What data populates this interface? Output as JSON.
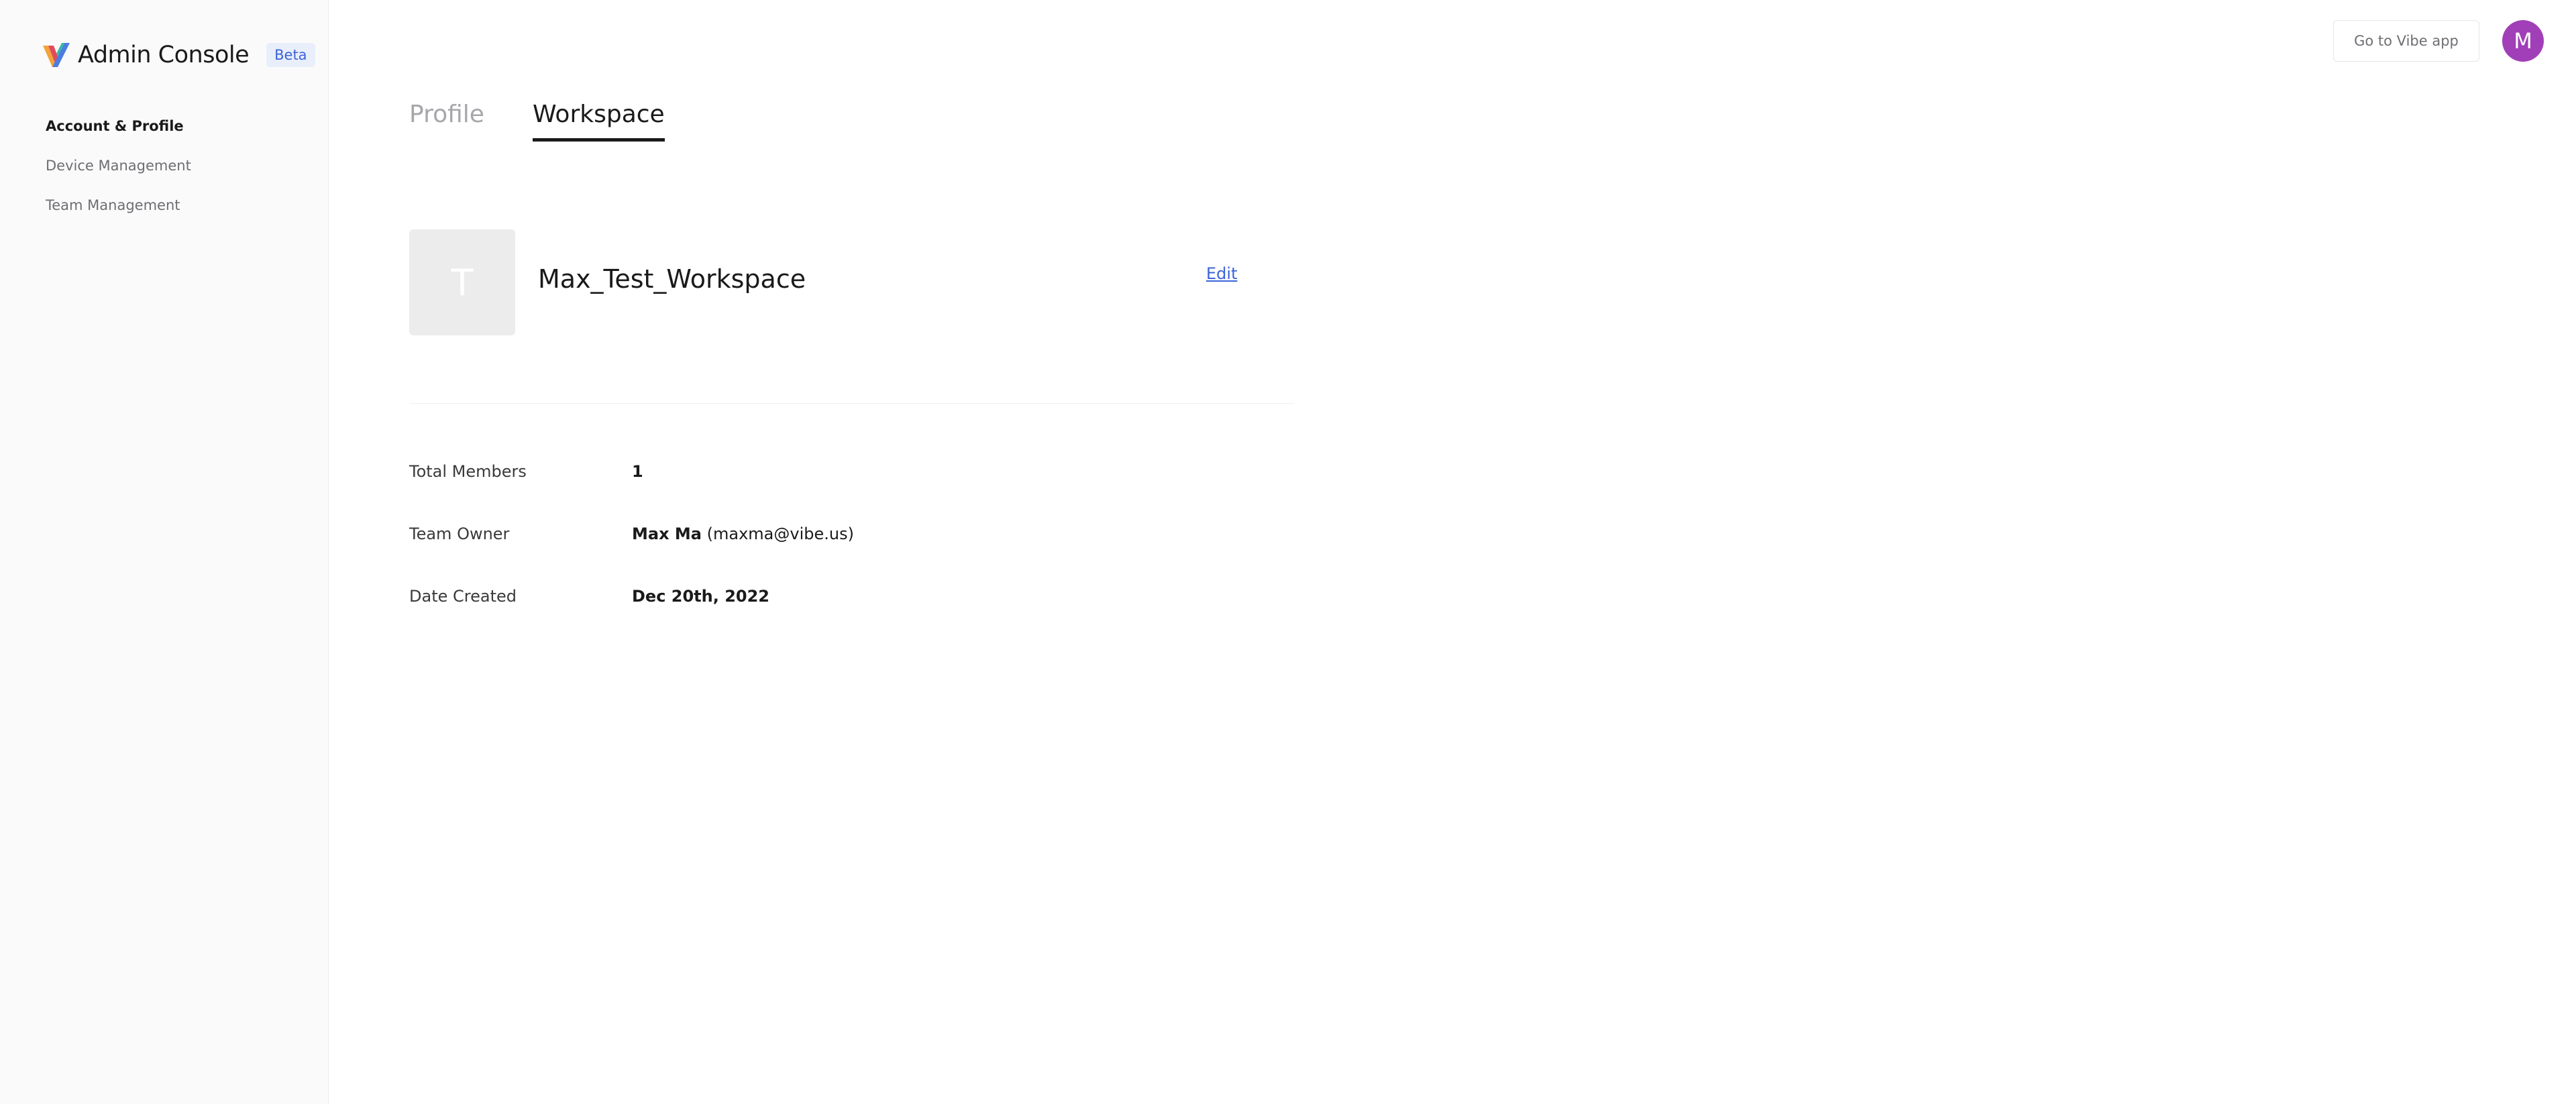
{
  "brand": {
    "title": "Admin Console",
    "badge": "Beta",
    "logo_icon": "vibe-logo-icon"
  },
  "sidebar": {
    "items": [
      {
        "label": "Account & Profile",
        "active": true
      },
      {
        "label": "Device Management",
        "active": false
      },
      {
        "label": "Team Management",
        "active": false
      }
    ]
  },
  "topbar": {
    "go_to_app_label": "Go to Vibe app",
    "avatar_initial": "M",
    "avatar_color": "#a13fb8"
  },
  "tabs": [
    {
      "label": "Profile",
      "active": false
    },
    {
      "label": "Workspace",
      "active": true
    }
  ],
  "workspace": {
    "avatar_initial": "T",
    "name": "Max_Test_Workspace",
    "edit_label": "Edit"
  },
  "details": {
    "total_members_label": "Total Members",
    "total_members_value": "1",
    "team_owner_label": "Team Owner",
    "team_owner_name": "Max Ma",
    "team_owner_email": "(maxma@vibe.us)",
    "date_created_label": "Date Created",
    "date_created_value": "Dec 20th, 2022"
  },
  "colors": {
    "accent": "#3a63d8",
    "avatar": "#a13fb8",
    "sidebar_bg": "#fafafa"
  }
}
